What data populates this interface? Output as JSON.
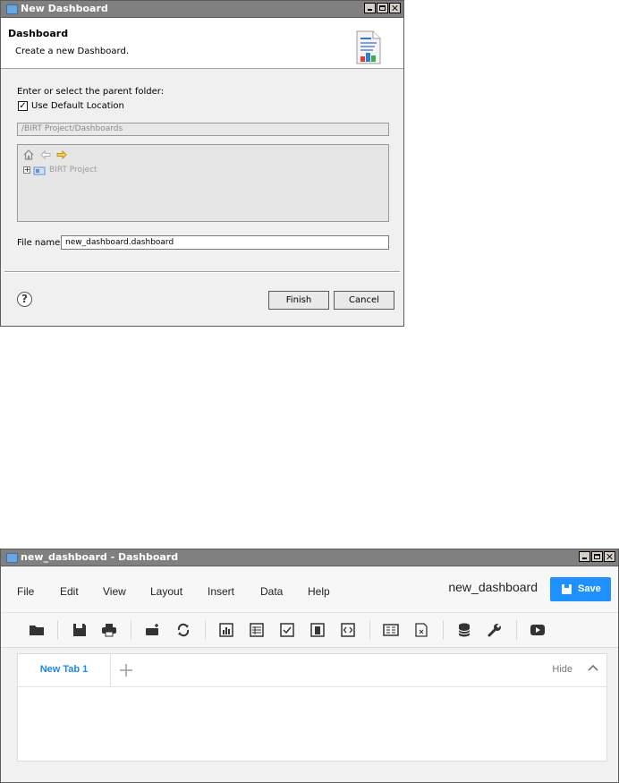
{
  "dialog": {
    "window_title": "New Dashboard",
    "header_title": "Dashboard",
    "header_subtitle": "Create a new Dashboard.",
    "parent_folder_label": "Enter or select the parent folder:",
    "use_default_location": {
      "label": "Use Default Location",
      "checked": true
    },
    "location_path": "/BIRT Project/Dashboards",
    "tree": {
      "items": [
        {
          "label": "BIRT Project",
          "expander": "+"
        }
      ]
    },
    "file_name_label": "File name:",
    "file_name_value": "new_dashboard.dashboard",
    "help_glyph": "?",
    "finish_label": "Finish",
    "cancel_label": "Cancel"
  },
  "dashboard": {
    "window_title": "new_dashboard - Dashboard",
    "menu": [
      "File",
      "Edit",
      "View",
      "Layout",
      "Insert",
      "Data",
      "Help"
    ],
    "document_name": "new_dashboard",
    "save_label": "Save",
    "toolbar_icons": [
      "open-folder-icon",
      "save-icon",
      "print-icon",
      "new-tab-icon",
      "refresh-icon",
      "chart-gadget-icon",
      "table-gadget-icon",
      "selector-gadget-icon",
      "report-gadget-icon",
      "html-gadget-icon",
      "data-selection-icon",
      "extras-icon",
      "database-icon",
      "settings-icon",
      "video-icon"
    ],
    "tabs": [
      {
        "label": "New Tab 1",
        "active": true
      }
    ],
    "add_tab_glyph": "+",
    "hide_label": "Hide",
    "accent_color": "#1e90ff"
  }
}
